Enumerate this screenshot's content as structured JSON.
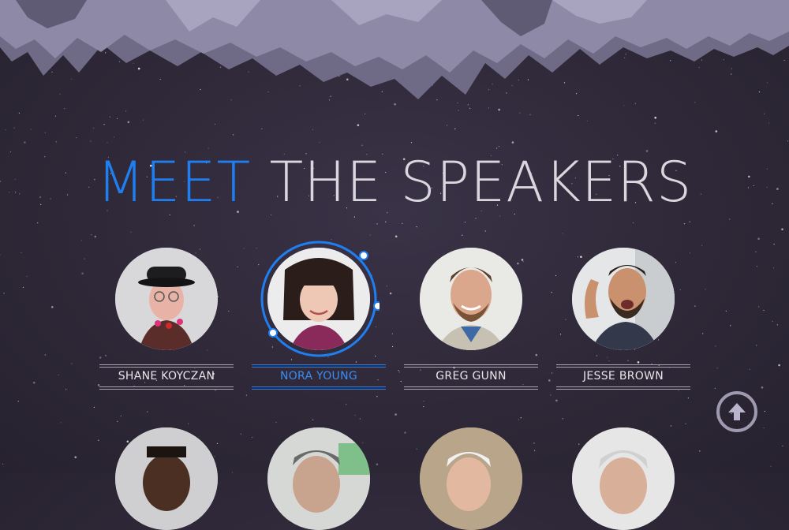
{
  "heading": {
    "accent": "MEET",
    "rest": " THE SPEAKERS"
  },
  "colors": {
    "accent": "#1f7ff0",
    "text": "#d9d6dd",
    "background": "#2e2838",
    "rock": "#8d89a6"
  },
  "speakers": [
    {
      "name": "SHANE KOYCZAN",
      "active": false,
      "photo": "portrait-bowler-hat"
    },
    {
      "name": "NORA YOUNG",
      "active": true,
      "photo": "portrait-bob-haircut"
    },
    {
      "name": "GREG GUNN",
      "active": false,
      "photo": "portrait-smiling-beard"
    },
    {
      "name": "JESSE BROWN",
      "active": false,
      "photo": "portrait-laughing-beard"
    }
  ],
  "second_row_photos": [
    "portrait-man-dark",
    "portrait-man-glasses",
    "portrait-man-white-hair",
    "portrait-man-gray-hair"
  ],
  "scroll_top": {
    "icon": "arrow-up-icon"
  }
}
